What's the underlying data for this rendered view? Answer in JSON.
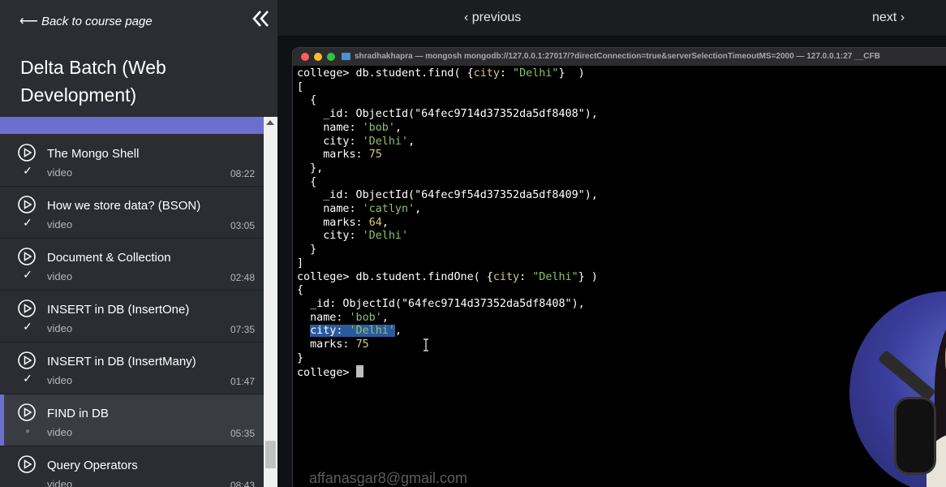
{
  "sidebar": {
    "back_label": "Back to course page",
    "course_title": "Delta Batch (Web Development)",
    "lessons": [
      {
        "title": "The Mongo Shell",
        "type": "video",
        "duration": "08:22",
        "status": "✓"
      },
      {
        "title": "How we store data? (BSON)",
        "type": "video",
        "duration": "03:05",
        "status": "✓"
      },
      {
        "title": "Document & Collection",
        "type": "video",
        "duration": "02:48",
        "status": "✓"
      },
      {
        "title": "INSERT in DB (InsertOne)",
        "type": "video",
        "duration": "07:35",
        "status": "✓"
      },
      {
        "title": "INSERT in DB (InsertMany)",
        "type": "video",
        "duration": "01:47",
        "status": "✓"
      },
      {
        "title": "FIND in DB",
        "type": "video",
        "duration": "05:35",
        "status": "●",
        "active": true
      },
      {
        "title": "Query Operators",
        "type": "video",
        "duration": "08:43",
        "status": ""
      }
    ]
  },
  "nav": {
    "previous_label": "previous",
    "next_label": "next"
  },
  "terminal": {
    "window_title": "shradhakhapra — mongosh mongodb://127.0.0.1:27017/?directConnection=true&serverSelectionTimeoutMS=2000 — 127.0.0.1:27 __CFB",
    "watermark": "affanasgar8@gmail.com",
    "lines": [
      "college> db.student.find( {city: \"Delhi\"}  )",
      "[",
      "  {",
      "    _id: ObjectId(\"64fec9714d37352da5df8408\"),",
      "    name: 'bob',",
      "    city: 'Delhi',",
      "    marks: 75",
      "  },",
      "  {",
      "    _id: ObjectId(\"64fec9f54d37352da5df8409\"),",
      "    name: 'catlyn',",
      "    marks: 64,",
      "    city: 'Delhi'",
      "  }",
      "]",
      "college> db.student.findOne( {city: \"Delhi\"} )",
      "{",
      "  _id: ObjectId(\"64fec9714d37352da5df8408\"),",
      "  name: 'bob',",
      "  city: 'Delhi',",
      "  marks: 75",
      "}",
      "college> "
    ]
  },
  "colors": {
    "accent": "#6b6fcf",
    "string_green": "#8ec26b",
    "number_yellow": "#d7c87a",
    "selection": "#2a5a9e"
  }
}
